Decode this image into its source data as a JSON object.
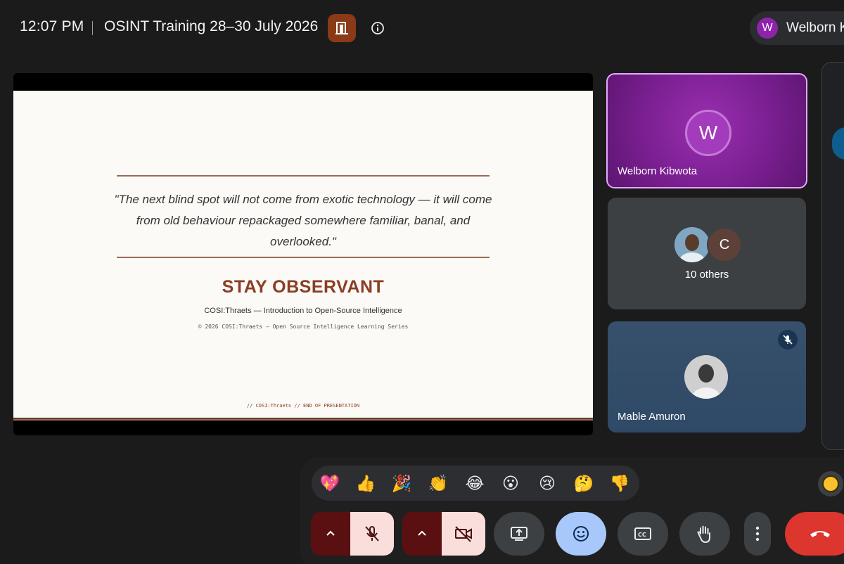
{
  "header": {
    "time": "12:07 PM",
    "meeting_title": "OSINT Training 28–30 July 2026",
    "user": {
      "initial": "W",
      "name": "Welborn K"
    }
  },
  "presentation": {
    "quote": "\"The next blind spot will not come from exotic technology — it will come from old behaviour repackaged somewhere familiar, banal, and overlooked.\"",
    "heading": "STAY OBSERVANT",
    "subtitle": "COSI:Thraets — Introduction to Open-Source Intelligence",
    "copyright": "© 2026 COSI:Thraets — Open Source Intelligence Learning Series",
    "footer": "// COSI:Thraets // END OF PRESENTATION"
  },
  "tiles": {
    "self": {
      "initial": "W",
      "name": "Welborn Kibwota"
    },
    "others": {
      "avatar_initial": "C",
      "count_label": "10 others"
    },
    "participant": {
      "name": "Mable Amuron",
      "muted": true
    }
  },
  "reactions": [
    "💖",
    "👍",
    "🎉",
    "👏",
    "😂",
    "😮",
    "😢",
    "🤔",
    "👎"
  ],
  "colors": {
    "background": "#1b1b1c",
    "accent_purple": "#8e24aa",
    "slide_accent": "#8a3d25",
    "end_call_red": "#dc362e",
    "active_blue": "#a8c7fa",
    "muted_red_bg": "#f9dedc"
  },
  "icons": {
    "door": "door-icon",
    "info": "info-icon",
    "mic_off": "mic-off-icon",
    "cam_off": "camera-off-icon",
    "present": "present-screen-icon",
    "emoji": "emoji-icon",
    "captions": "captions-icon",
    "hand": "raise-hand-icon",
    "more": "more-vert-icon",
    "end": "end-call-icon"
  }
}
